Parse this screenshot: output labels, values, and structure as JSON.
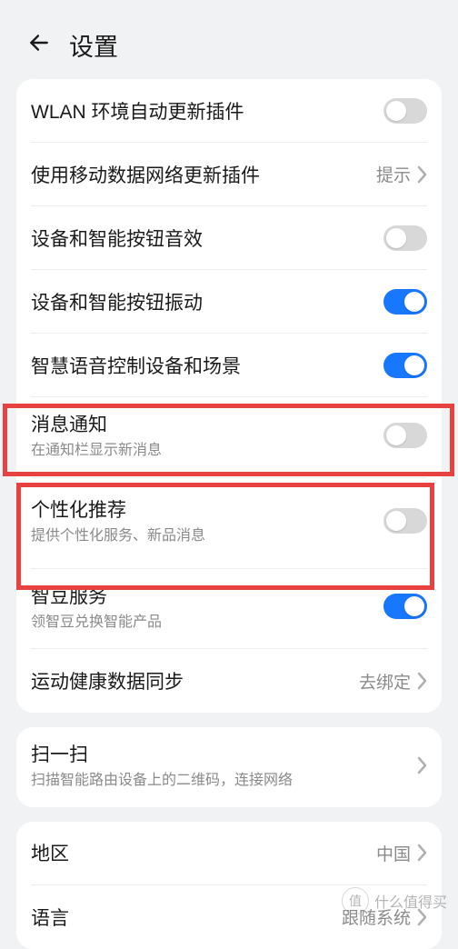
{
  "header": {
    "title": "设置"
  },
  "sections": {
    "s1": {
      "wlan_update": {
        "title": "WLAN 环境自动更新插件",
        "on": false
      },
      "mobile_update": {
        "title": "使用移动数据网络更新插件",
        "value": "提示"
      },
      "sound_effect": {
        "title": "设备和智能按钮音效",
        "on": false
      },
      "vibration": {
        "title": "设备和智能按钮振动",
        "on": true
      },
      "voice_control": {
        "title": "智慧语音控制设备和场景",
        "on": true
      },
      "notifications": {
        "title": "消息通知",
        "sub": "在通知栏显示新消息",
        "on": false
      },
      "personalized": {
        "title": "个性化推荐",
        "sub": "提供个性化服务、新品消息",
        "on": false
      },
      "zhidou": {
        "title": "智豆服务",
        "sub": "领智豆兑换智能产品",
        "on": true
      },
      "health_sync": {
        "title": "运动健康数据同步",
        "value": "去绑定"
      }
    },
    "s2": {
      "scan": {
        "title": "扫一扫",
        "sub": "扫描智能路由设备上的二维码，连接网络"
      }
    },
    "s3": {
      "region": {
        "title": "地区",
        "value": "中国"
      },
      "lang": {
        "title": "语言",
        "value": "跟随系统"
      }
    }
  },
  "watermark": {
    "logo": "值",
    "text": "什么值得买"
  }
}
